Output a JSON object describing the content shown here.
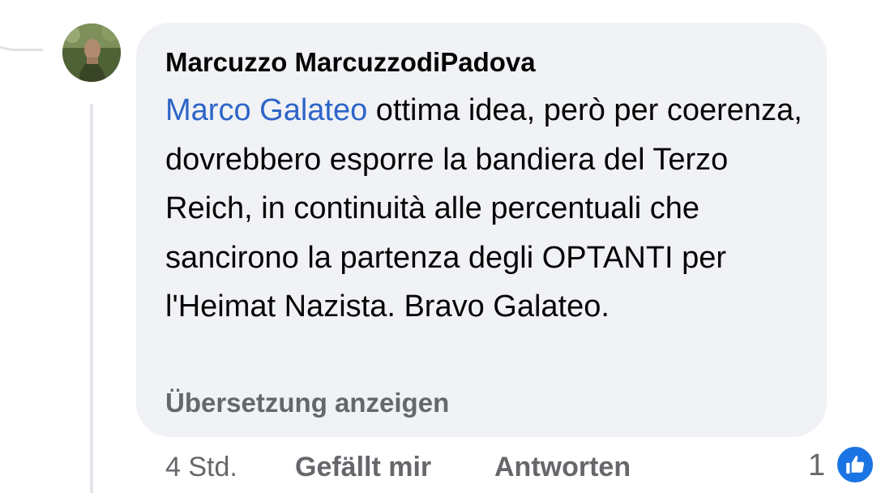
{
  "comment": {
    "author": "Marcuzzo MarcuzzodiPadova",
    "mention": "Marco Galateo",
    "text": " ottima idea, però per coerenza, dovrebbero esporre la bandiera del Terzo Reich, in continuità alle percentuali che sancirono la partenza degli OPTANTI per l'Heimat Nazista. Bravo Galateo.",
    "translate_label": "Übersetzung anzeigen"
  },
  "actions": {
    "time": "4 Std.",
    "like_label": "Gefällt mir",
    "reply_label": "Antworten"
  },
  "reactions": {
    "count": "1",
    "icon": "thumbs-up-icon"
  },
  "colors": {
    "bubble": "#f0f2f5",
    "mention": "#2d65c8",
    "secondary_text": "#65676b",
    "like_badge": "#1b74e4"
  }
}
